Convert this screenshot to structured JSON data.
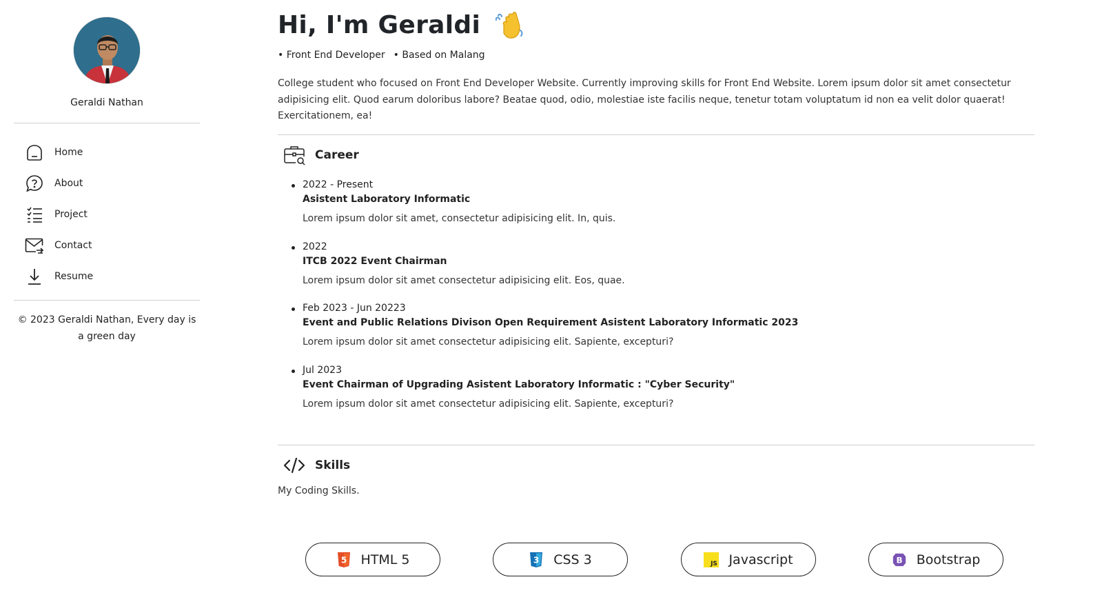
{
  "sidebar": {
    "profile_name": "Geraldi Nathan",
    "nav": [
      {
        "label": "Home",
        "icon": "home-icon"
      },
      {
        "label": "About",
        "icon": "question-icon"
      },
      {
        "label": "Project",
        "icon": "list-check-icon"
      },
      {
        "label": "Contact",
        "icon": "mail-icon"
      },
      {
        "label": "Resume",
        "icon": "download-icon"
      }
    ],
    "footer": "© 2023 Geraldi Nathan, Every day is a green day"
  },
  "header": {
    "title": "Hi, I'm Geraldi",
    "tag1": "• Front End Developer",
    "tag2": "• Based on Malang"
  },
  "bio": "College student who focused on Front End Developer Website. Currently improving skills for Front End Website. Lorem ipsum dolor sit amet consectetur adipisicing elit. Quod earum doloribus labore? Beatae quod, odio, molestiae iste facilis neque, tenetur totam voluptatum id non ea velit dolor quaerat! Exercitationem, ea!",
  "career": {
    "title": "Career",
    "items": [
      {
        "date": "2022 - Present",
        "role": "Asistent Laboratory Informatic",
        "desc": "Lorem ipsum dolor sit amet, consectetur adipisicing elit. In, quis."
      },
      {
        "date": "2022",
        "role": "ITCB 2022 Event Chairman",
        "desc": "Lorem ipsum dolor sit amet consectetur adipisicing elit. Eos, quae."
      },
      {
        "date": "Feb 2023 - Jun 20223",
        "role": "Event and Public Relations Divison Open Requirement Asistent Laboratory Informatic 2023",
        "desc": "Lorem ipsum dolor sit amet consectetur adipisicing elit. Sapiente, excepturi?"
      },
      {
        "date": "Jul 2023",
        "role": "Event Chairman of Upgrading Asistent Laboratory Informatic : \"Cyber Security\"",
        "desc": "Lorem ipsum dolor sit amet consectetur adipisicing elit. Sapiente, excepturi?"
      }
    ]
  },
  "skills": {
    "title": "Skills",
    "subtitle": "My Coding Skills.",
    "items": [
      {
        "label": "HTML 5",
        "icon": "html5-icon",
        "color": "#e44d26",
        "glyph": "5"
      },
      {
        "label": "CSS 3",
        "icon": "css3-icon",
        "color": "#1572b6",
        "glyph": "3"
      },
      {
        "label": "Javascript",
        "icon": "javascript-icon",
        "color": "#f7df1e",
        "glyph": "JS"
      },
      {
        "label": "Bootstrap",
        "icon": "bootstrap-icon",
        "color": "#7952b3",
        "glyph": "B"
      }
    ]
  }
}
